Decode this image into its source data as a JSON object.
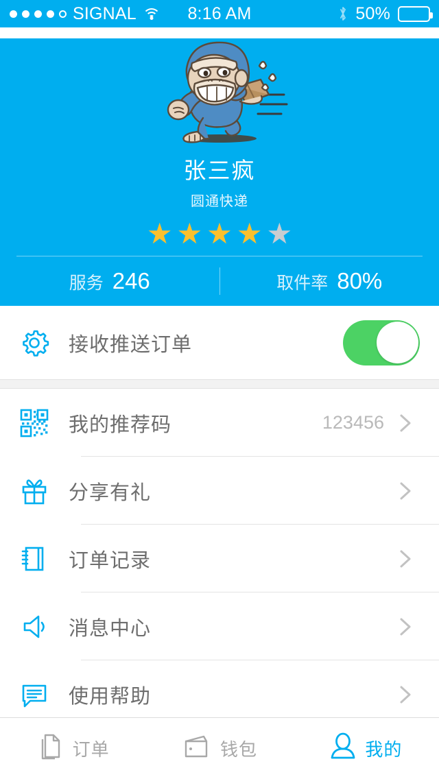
{
  "colors": {
    "brand_blue": "#00AEEF",
    "toggle_green": "#4CD264",
    "star_gold": "#FBC02D",
    "star_gray": "#C9CDD0",
    "text_gray": "#6d6d6d",
    "muted_gray": "#b9b9b9"
  },
  "statusbar": {
    "carrier": "SIGNAL",
    "time": "8:16 AM",
    "battery_percent": "50%",
    "battery_level": 50,
    "signal_dots_filled": 4,
    "signal_dots_total": 5,
    "wifi_icon": "wifi-icon",
    "bluetooth_icon": "bluetooth-icon",
    "battery_icon": "battery-icon"
  },
  "header": {
    "avatar_icon": "courier-monkey-mascot",
    "name": "张三疯",
    "company": "圆通快递",
    "rating": 4,
    "rating_max": 5,
    "stats": [
      {
        "label": "服务",
        "value": "246"
      },
      {
        "label": "取件率",
        "value": "80%"
      }
    ]
  },
  "settings": {
    "push_orders": {
      "icon": "gear-icon",
      "label": "接收推送订单",
      "enabled": true
    }
  },
  "menu": {
    "items": [
      {
        "icon": "qrcode-icon",
        "label": "我的推荐码",
        "value": "123456",
        "chevron": "chevron-right-icon"
      },
      {
        "icon": "gift-icon",
        "label": "分享有礼",
        "value": "",
        "chevron": "chevron-right-icon"
      },
      {
        "icon": "notebook-icon",
        "label": "订单记录",
        "value": "",
        "chevron": "chevron-right-icon"
      },
      {
        "icon": "speaker-icon",
        "label": "消息中心",
        "value": "",
        "chevron": "chevron-right-icon"
      },
      {
        "icon": "chat-icon",
        "label": "使用帮助",
        "value": "",
        "chevron": "chevron-right-icon"
      }
    ]
  },
  "tabbar": {
    "tabs": [
      {
        "icon": "documents-icon",
        "label": "订单",
        "active": false
      },
      {
        "icon": "wallet-icon",
        "label": "钱包",
        "active": false
      },
      {
        "icon": "person-icon",
        "label": "我的",
        "active": true
      }
    ]
  }
}
